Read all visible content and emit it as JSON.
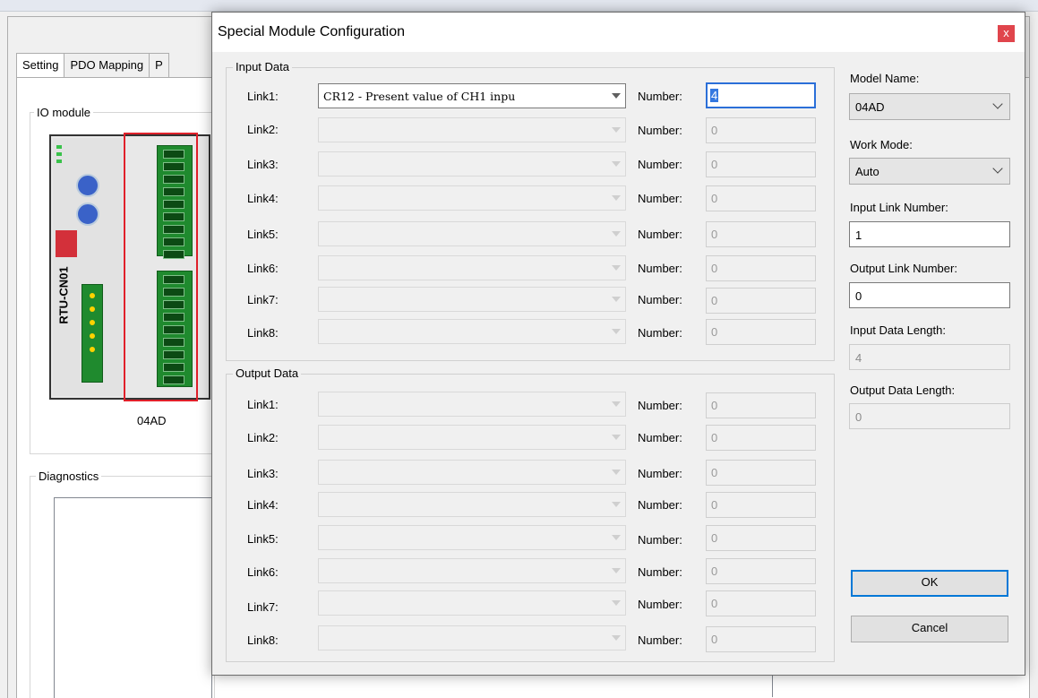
{
  "background": {
    "tabs": [
      "Setting",
      "PDO Mapping",
      "P"
    ],
    "io_module_label": "IO module",
    "module_caption": "04AD",
    "module_device_label": "RTU-CN01",
    "diagnostics_label": "Diagnostics"
  },
  "dialog": {
    "title": "Special Module Configuration",
    "close_glyph": "x",
    "input_group": {
      "legend": "Input Data",
      "rows": [
        {
          "label": "Link1:",
          "select": "CR12 - Present value of CH1 inpu",
          "number_label": "Number:",
          "number": "4"
        },
        {
          "label": "Link2:",
          "select": "",
          "number_label": "Number:",
          "number": "0"
        },
        {
          "label": "Link3:",
          "select": "",
          "number_label": "Number:",
          "number": "0"
        },
        {
          "label": "Link4:",
          "select": "",
          "number_label": "Number:",
          "number": "0"
        },
        {
          "label": "Link5:",
          "select": "",
          "number_label": "Number:",
          "number": "0"
        },
        {
          "label": "Link6:",
          "select": "",
          "number_label": "Number:",
          "number": "0"
        },
        {
          "label": "Link7:",
          "select": "",
          "number_label": "Number:",
          "number": "0"
        },
        {
          "label": "Link8:",
          "select": "",
          "number_label": "Number:",
          "number": "0"
        }
      ]
    },
    "output_group": {
      "legend": "Output Data",
      "rows": [
        {
          "label": "Link1:",
          "select": "",
          "number_label": "Number:",
          "number": "0"
        },
        {
          "label": "Link2:",
          "select": "",
          "number_label": "Number:",
          "number": "0"
        },
        {
          "label": "Link3:",
          "select": "",
          "number_label": "Number:",
          "number": "0"
        },
        {
          "label": "Link4:",
          "select": "",
          "number_label": "Number:",
          "number": "0"
        },
        {
          "label": "Link5:",
          "select": "",
          "number_label": "Number:",
          "number": "0"
        },
        {
          "label": "Link6:",
          "select": "",
          "number_label": "Number:",
          "number": "0"
        },
        {
          "label": "Link7:",
          "select": "",
          "number_label": "Number:",
          "number": "0"
        },
        {
          "label": "Link8:",
          "select": "",
          "number_label": "Number:",
          "number": "0"
        }
      ]
    },
    "side": {
      "model_name_label": "Model Name:",
      "model_name": "04AD",
      "work_mode_label": "Work Mode:",
      "work_mode": "Auto",
      "input_link_number_label": "Input Link Number:",
      "input_link_number": "1",
      "output_link_number_label": "Output Link Number:",
      "output_link_number": "0",
      "input_data_length_label": "Input Data Length:",
      "input_data_length": "4",
      "output_data_length_label": "Output Data Length:",
      "output_data_length": "0",
      "ok_label": "OK",
      "cancel_label": "Cancel"
    }
  },
  "colors": {
    "focus_border": "#2b6fd8",
    "close_button": "#e0454c",
    "module_highlight": "#e0202a"
  }
}
